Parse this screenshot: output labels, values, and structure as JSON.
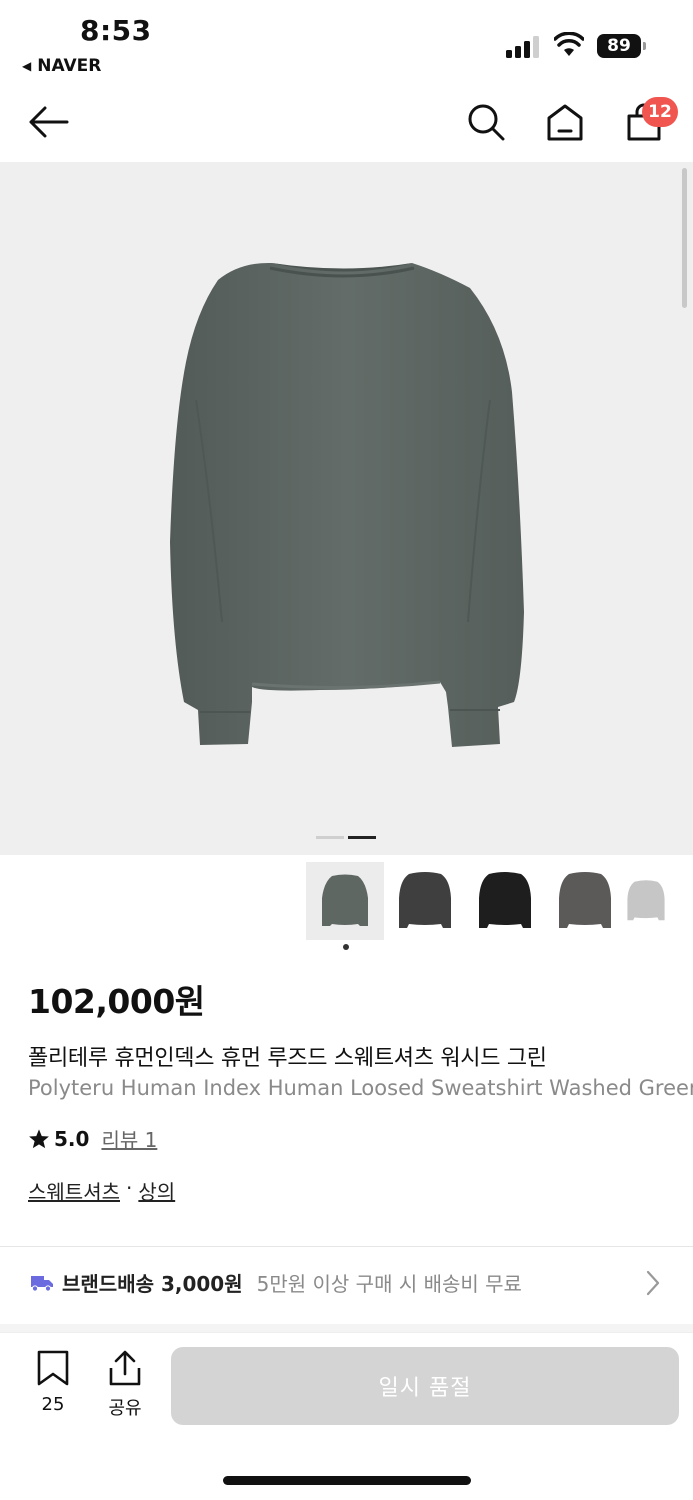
{
  "status": {
    "time": "8:53",
    "back_app": "NAVER",
    "battery": "89"
  },
  "header": {
    "cart_count": "12"
  },
  "gallery": {
    "slide_count": 2,
    "active_slide": 2,
    "thumbnail_colors": [
      "#5f6763",
      "#3f3f3f",
      "#1e1e1e",
      "#5c5959",
      "#c6c6c6"
    ]
  },
  "product": {
    "price": "102,000원",
    "title_ko": "폴리테루 휴먼인덱스 휴먼 루즈드 스웨트셔츠 워시드 그린",
    "title_en": "Polyteru Human Index Human Loosed Sweatshirt Washed Green",
    "rating": "5.0",
    "review": "리뷰 1",
    "category_1": "스웨트셔츠",
    "category_sep": "·",
    "category_2": "상의"
  },
  "shipping": {
    "label": "브랜드배송 3,000원",
    "note": "5만원 이상 구매 시 배송비 무료"
  },
  "bottom_bar": {
    "bookmark_count": "25",
    "share_label": "공유",
    "buy_label": "일시 품절"
  },
  "colors": {
    "badge": "#f05550",
    "soldout": "#d4d4d4",
    "shipping_truck": "#6b6bdf"
  }
}
